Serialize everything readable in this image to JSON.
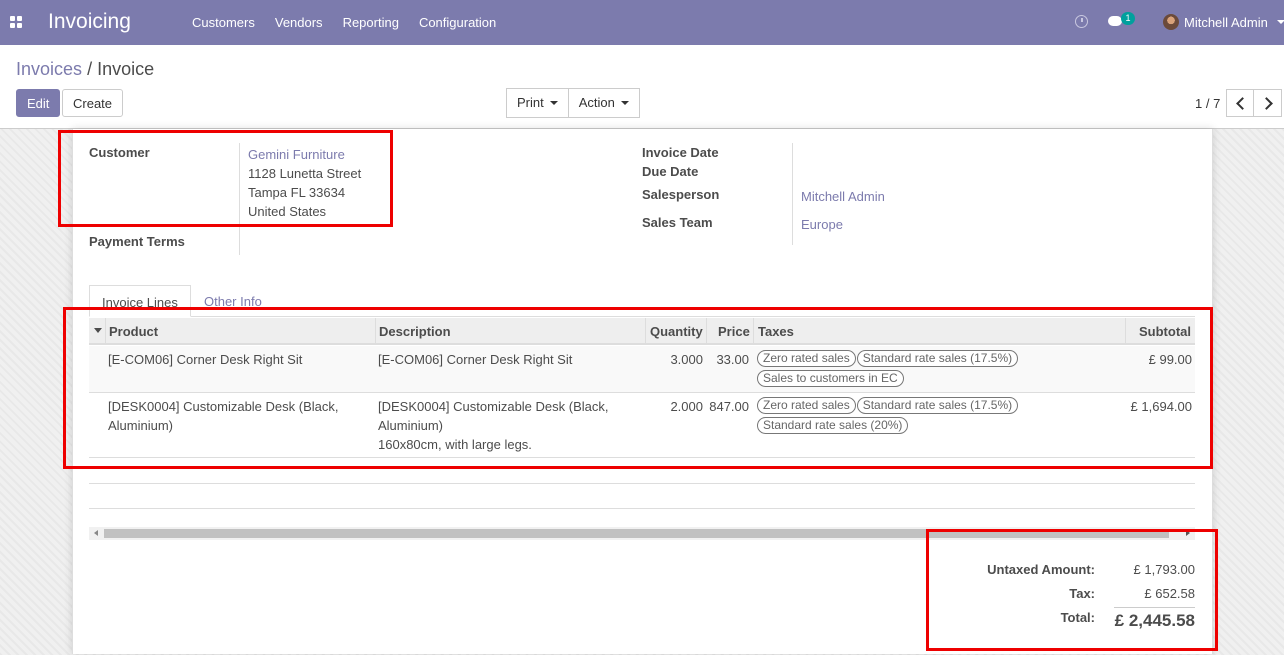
{
  "navbar": {
    "app_title": "Invoicing",
    "menu": [
      "Customers",
      "Vendors",
      "Reporting",
      "Configuration"
    ],
    "chat_count": "1",
    "user": "Mitchell Admin",
    "color": "#7c7bad"
  },
  "control": {
    "breadcrumb_parent": "Invoices",
    "breadcrumb_sep": "/",
    "breadcrumb_current": "Invoice",
    "edit_label": "Edit",
    "create_label": "Create",
    "print_label": "Print",
    "action_label": "Action",
    "pager": "1 / 7"
  },
  "form": {
    "customer_label": "Customer",
    "customer_name": "Gemini Furniture",
    "address_line1": "1128 Lunetta Street",
    "address_line2": "Tampa FL 33634",
    "address_line3": "United States",
    "payment_terms_label": "Payment Terms",
    "invoice_date_label": "Invoice Date",
    "due_date_label": "Due Date",
    "salesperson_label": "Salesperson",
    "salesperson": "Mitchell Admin",
    "sales_team_label": "Sales Team",
    "sales_team": "Europe"
  },
  "tabs": {
    "invoice_lines": "Invoice Lines",
    "other_info": "Other Info"
  },
  "table": {
    "headers": {
      "product": "Product",
      "description": "Description",
      "quantity": "Quantity",
      "price": "Price",
      "taxes": "Taxes",
      "subtotal": "Subtotal"
    },
    "rows": [
      {
        "product": "[E-COM06] Corner Desk Right Sit",
        "description_1": "[E-COM06] Corner Desk Right Sit",
        "quantity": "3.000",
        "price": "33.00",
        "taxes": [
          "Zero rated sales",
          "Standard rate sales (17.5%)",
          "Sales to customers in EC"
        ],
        "subtotal": "£ 99.00"
      },
      {
        "product_1": "[DESK0004] Customizable Desk (Black,",
        "product_2": "Aluminium)",
        "description_1": "[DESK0004] Customizable Desk (Black,",
        "description_2": "Aluminium)",
        "description_3": "160x80cm, with large legs.",
        "quantity": "2.000",
        "price": "847.00",
        "taxes": [
          "Zero rated sales",
          "Standard rate sales (17.5%)",
          "Standard rate sales (20%)"
        ],
        "subtotal": "£ 1,694.00"
      }
    ]
  },
  "totals": {
    "untaxed_label": "Untaxed Amount:",
    "untaxed": "£ 1,793.00",
    "tax_label": "Tax:",
    "tax": "£ 652.58",
    "total_label": "Total:",
    "total": "£ 2,445.58"
  },
  "annotation_color": "#ee0000"
}
